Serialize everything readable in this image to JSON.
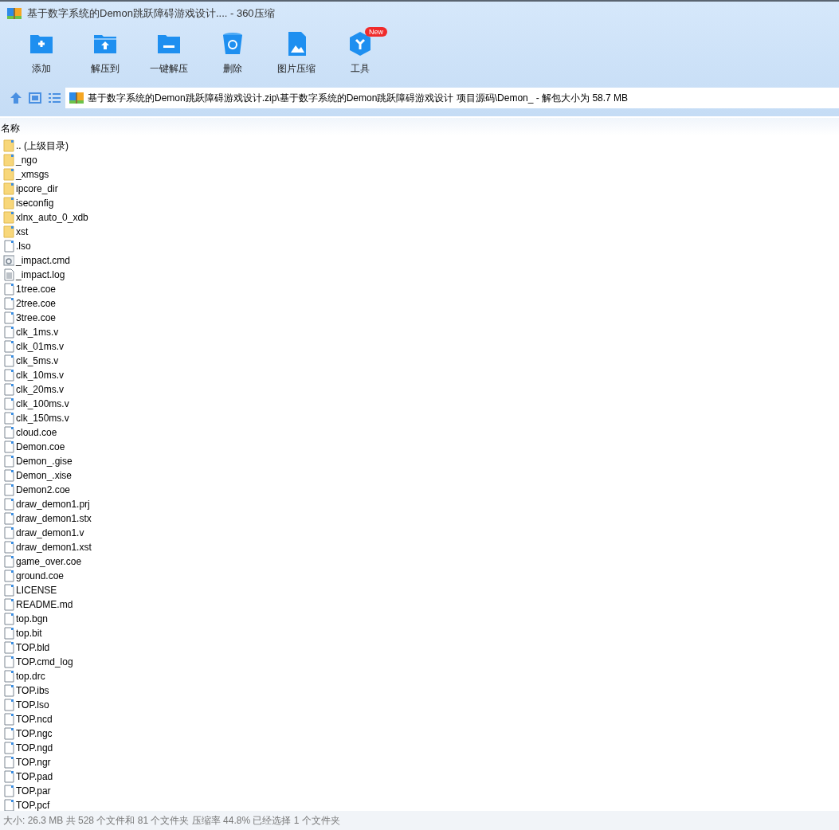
{
  "window": {
    "title": "基于数字系统的Demon跳跃障碍游戏设计.... - 360压缩"
  },
  "toolbar": [
    {
      "kind": "add",
      "label": "添加"
    },
    {
      "kind": "extract_to",
      "label": "解压到"
    },
    {
      "kind": "one_click_extract",
      "label": "一键解压"
    },
    {
      "kind": "delete",
      "label": "删除"
    },
    {
      "kind": "image_compress",
      "label": "图片压缩"
    },
    {
      "kind": "tools",
      "label": "工具",
      "badge": "New"
    }
  ],
  "address_bar": {
    "path": "基于数字系统的Demon跳跃障碍游戏设计.zip\\基于数字系统的Demon跳跃障碍游戏设计 项目源码\\Demon_ - 解包大小为 58.7 MB"
  },
  "file_list": {
    "columns": [
      "名称"
    ],
    "rows": [
      {
        "kind": "folder",
        "name": ".. (上级目录)"
      },
      {
        "kind": "folder",
        "name": "_ngo"
      },
      {
        "kind": "folder",
        "name": "_xmsgs"
      },
      {
        "kind": "folder",
        "name": "ipcore_dir"
      },
      {
        "kind": "folder",
        "name": "iseconfig"
      },
      {
        "kind": "folder",
        "name": "xlnx_auto_0_xdb"
      },
      {
        "kind": "folder",
        "name": "xst"
      },
      {
        "kind": "file",
        "name": ".lso"
      },
      {
        "kind": "command",
        "name": "_impact.cmd"
      },
      {
        "kind": "text",
        "name": "_impact.log"
      },
      {
        "kind": "file",
        "name": "1tree.coe"
      },
      {
        "kind": "file",
        "name": "2tree.coe"
      },
      {
        "kind": "file",
        "name": "3tree.coe"
      },
      {
        "kind": "file",
        "name": "clk_1ms.v"
      },
      {
        "kind": "file",
        "name": "clk_01ms.v"
      },
      {
        "kind": "file",
        "name": "clk_5ms.v"
      },
      {
        "kind": "file",
        "name": "clk_10ms.v"
      },
      {
        "kind": "file",
        "name": "clk_20ms.v"
      },
      {
        "kind": "file",
        "name": "clk_100ms.v"
      },
      {
        "kind": "file",
        "name": "clk_150ms.v"
      },
      {
        "kind": "file",
        "name": "cloud.coe"
      },
      {
        "kind": "file",
        "name": "Demon.coe"
      },
      {
        "kind": "file",
        "name": "Demon_.gise"
      },
      {
        "kind": "file",
        "name": "Demon_.xise"
      },
      {
        "kind": "file",
        "name": "Demon2.coe"
      },
      {
        "kind": "file",
        "name": "draw_demon1.prj"
      },
      {
        "kind": "file",
        "name": "draw_demon1.stx"
      },
      {
        "kind": "file",
        "name": "draw_demon1.v"
      },
      {
        "kind": "file",
        "name": "draw_demon1.xst"
      },
      {
        "kind": "file",
        "name": "game_over.coe"
      },
      {
        "kind": "file",
        "name": "ground.coe"
      },
      {
        "kind": "file",
        "name": "LICENSE"
      },
      {
        "kind": "file",
        "name": "README.md"
      },
      {
        "kind": "file",
        "name": "top.bgn"
      },
      {
        "kind": "file",
        "name": "top.bit"
      },
      {
        "kind": "file",
        "name": "TOP.bld"
      },
      {
        "kind": "file",
        "name": "TOP.cmd_log"
      },
      {
        "kind": "file",
        "name": "top.drc"
      },
      {
        "kind": "file",
        "name": "TOP.ibs"
      },
      {
        "kind": "file",
        "name": "TOP.lso"
      },
      {
        "kind": "file",
        "name": "TOP.ncd"
      },
      {
        "kind": "file",
        "name": "TOP.ngc"
      },
      {
        "kind": "file",
        "name": "TOP.ngd"
      },
      {
        "kind": "file",
        "name": "TOP.ngr"
      },
      {
        "kind": "file",
        "name": "TOP.pad"
      },
      {
        "kind": "file",
        "name": "TOP.par"
      },
      {
        "kind": "file",
        "name": "TOP.pcf"
      }
    ]
  },
  "status_bar": {
    "text": "大小: 26.3 MB 共 528 个文件和 81 个文件夹 压缩率 44.8% 已经选择 1 个文件夹"
  }
}
